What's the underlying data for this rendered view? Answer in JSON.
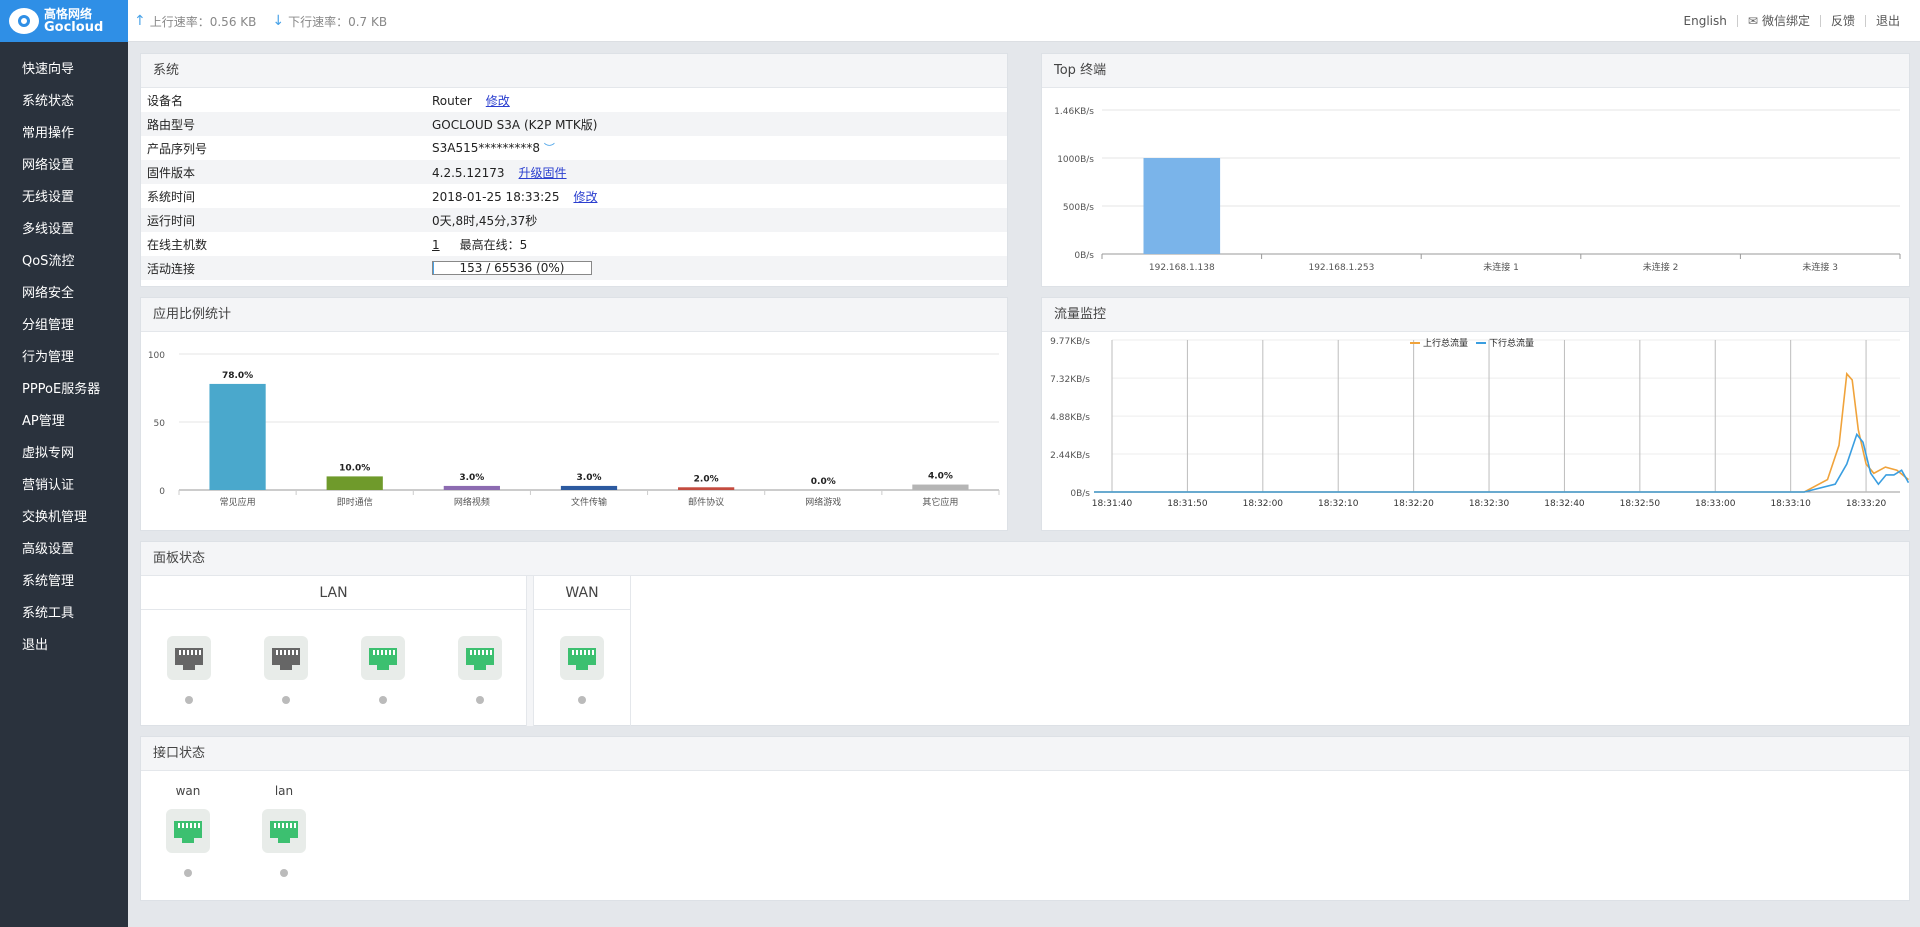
{
  "header": {
    "logo_cn": "高恪网络",
    "logo_en": "Gocloud",
    "upload_label": "上行速率：0.56 KB",
    "download_label": "下行速率：0.7 KB",
    "links": [
      "English",
      "微信绑定",
      "反馈",
      "退出"
    ]
  },
  "sidebar": {
    "items": [
      "快速向导",
      "系统状态",
      "常用操作",
      "网络设置",
      "无线设置",
      "多线设置",
      "QoS流控",
      "网络安全",
      "分组管理",
      "行为管理",
      "PPPoE服务器",
      "AP管理",
      "虚拟专网",
      "营销认证",
      "交换机管理",
      "高级设置",
      "系统管理",
      "系统工具",
      "退出"
    ]
  },
  "system": {
    "title": "系统",
    "rows": [
      {
        "label": "设备名",
        "value": "Router",
        "link": "修改"
      },
      {
        "label": "路由型号",
        "value": "GOCLOUD S3A (K2P MTK版)"
      },
      {
        "label": "产品序列号",
        "value": "S3A515*********8"
      },
      {
        "label": "固件版本",
        "value": "4.2.5.12173",
        "link": "升级固件"
      },
      {
        "label": "系统时间",
        "value": "2018-01-25 18:33:25",
        "link": "修改"
      },
      {
        "label": "运行时间",
        "value": "0天,8时,45分,37秒"
      },
      {
        "label": "在线主机数",
        "value": "1",
        "extra": "最高在线：5"
      },
      {
        "label": "活动连接",
        "value": "153 / 65536 (0%)",
        "progress": 0.0023
      }
    ]
  },
  "top_terminals": {
    "title": "Top 终端"
  },
  "app_stats": {
    "title": "应用比例统计"
  },
  "traffic": {
    "title": "流量监控"
  },
  "panel_status": {
    "title": "面板状态",
    "lan_label": "LAN",
    "wan_label": "WAN",
    "lan_ports": [
      {
        "state": "down"
      },
      {
        "state": "down"
      },
      {
        "state": "up"
      },
      {
        "state": "up"
      }
    ],
    "wan_ports": [
      {
        "state": "up"
      }
    ]
  },
  "iface_status": {
    "title": "接口状态",
    "interfaces": [
      {
        "name": "wan",
        "state": "up"
      },
      {
        "name": "lan",
        "state": "up"
      }
    ]
  },
  "colors": {
    "accent": "#2f8fe6",
    "port_up": "#3cc070",
    "port_down": "#666666",
    "upload_line": "#f0a33b",
    "download_line": "#3a9ee0"
  },
  "chart_data": [
    {
      "id": "top",
      "type": "bar",
      "categories": [
        "192.168.1.138",
        "192.168.1.253",
        "未连接 1",
        "未连接 2",
        "未连接 3"
      ],
      "values": [
        1000,
        0,
        0,
        0,
        0
      ],
      "ylim": [
        0,
        1500
      ],
      "yticks": [
        {
          "v": 0,
          "label": "0B/s"
        },
        {
          "v": 500,
          "label": "500B/s"
        },
        {
          "v": 1000,
          "label": "1000B/s"
        },
        {
          "v": 1500,
          "label": "1.46KB/s"
        }
      ],
      "color": "#7ab4ea",
      "grid": true
    },
    {
      "id": "apps",
      "type": "bar",
      "categories": [
        "常见应用",
        "即时通信",
        "网络视频",
        "文件传输",
        "邮件协议",
        "网络游戏",
        "其它应用"
      ],
      "values": [
        78.0,
        10.0,
        3.0,
        3.0,
        2.0,
        0.0,
        4.0
      ],
      "labels": [
        "78.0%",
        "10.0%",
        "3.0%",
        "3.0%",
        "2.0%",
        "0.0%",
        "4.0%"
      ],
      "colors": [
        "#4aa8cc",
        "#6f9a2b",
        "#8c6bb1",
        "#2c5aa0",
        "#c44b3f",
        "#cccccc",
        "#b5b5b5"
      ],
      "ylim": [
        0,
        100
      ],
      "yticks": [
        {
          "v": 0,
          "label": "0"
        },
        {
          "v": 50,
          "label": "50"
        },
        {
          "v": 100,
          "label": "100"
        }
      ],
      "grid": true
    },
    {
      "id": "traffic",
      "type": "line",
      "x": [
        "18:31:40",
        "18:31:50",
        "18:32:00",
        "18:32:10",
        "18:32:20",
        "18:32:30",
        "18:32:40",
        "18:32:50",
        "18:33:00",
        "18:33:10",
        "18:33:20"
      ],
      "yticks": [
        {
          "v": 0,
          "label": "0B/s"
        },
        {
          "v": 2.44,
          "label": "2.44KB/s"
        },
        {
          "v": 4.88,
          "label": "4.88KB/s"
        },
        {
          "v": 7.32,
          "label": "7.32KB/s"
        },
        {
          "v": 9.77,
          "label": "9.77KB/s"
        }
      ],
      "ylim": [
        0,
        9.77
      ],
      "series": [
        {
          "name": "上行总流量",
          "color": "#f0a33b",
          "points": [
            [
              0,
              0
            ],
            [
              92,
              0
            ],
            [
              95,
              0.8
            ],
            [
              96.5,
              3
            ],
            [
              97.5,
              7.6
            ],
            [
              98.2,
              7.2
            ],
            [
              99,
              4
            ],
            [
              100,
              1.8
            ],
            [
              101,
              1.2
            ],
            [
              102.5,
              1.6
            ],
            [
              104,
              1.4
            ],
            [
              105.5,
              0.8
            ]
          ]
        },
        {
          "name": "下行总流量",
          "color": "#3a9ee0",
          "points": [
            [
              0,
              0
            ],
            [
              92,
              0
            ],
            [
              96,
              0.5
            ],
            [
              97.5,
              1.8
            ],
            [
              98.8,
              3.7
            ],
            [
              99.6,
              3.2
            ],
            [
              100.6,
              1.2
            ],
            [
              101.6,
              0.5
            ],
            [
              102.6,
              1.1
            ],
            [
              103.6,
              1.1
            ],
            [
              104.6,
              1.4
            ],
            [
              105.5,
              0.6
            ]
          ]
        }
      ],
      "legend": "top-right",
      "grid": true
    }
  ]
}
